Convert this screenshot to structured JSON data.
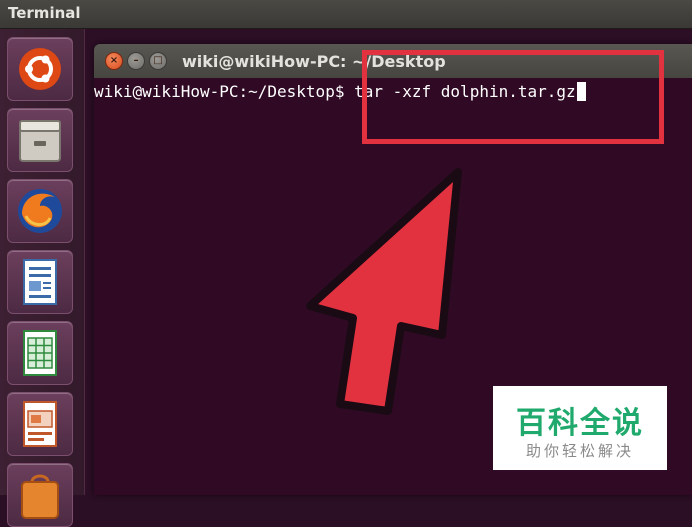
{
  "top_panel": {
    "app_title": "Terminal"
  },
  "launcher": {
    "items": [
      {
        "icon": "ubuntu-logo-icon"
      },
      {
        "icon": "file-cabinet-icon"
      },
      {
        "icon": "firefox-icon"
      },
      {
        "icon": "writer-document-icon"
      },
      {
        "icon": "calc-spreadsheet-icon"
      },
      {
        "icon": "impress-presentation-icon"
      },
      {
        "icon": "software-center-bag-icon"
      }
    ]
  },
  "terminal": {
    "window_title": "wiki@wikiHow-PC: ~/Desktop",
    "prompt": "wiki@wikiHow-PC:~/Desktop$ ",
    "command": "tar -xzf dolphin.tar.gz",
    "window_buttons": [
      "close",
      "minimize",
      "maximize"
    ]
  },
  "annotation": {
    "color": "#e2313f"
  },
  "watermark": {
    "main": "百科全说",
    "sub": "助你轻松解决"
  },
  "colors": {
    "terminal_bg": "#300a24",
    "launcher_bg": "#3d2033",
    "close_button": "#d94b1f",
    "watermark_green": "#20a96d"
  }
}
